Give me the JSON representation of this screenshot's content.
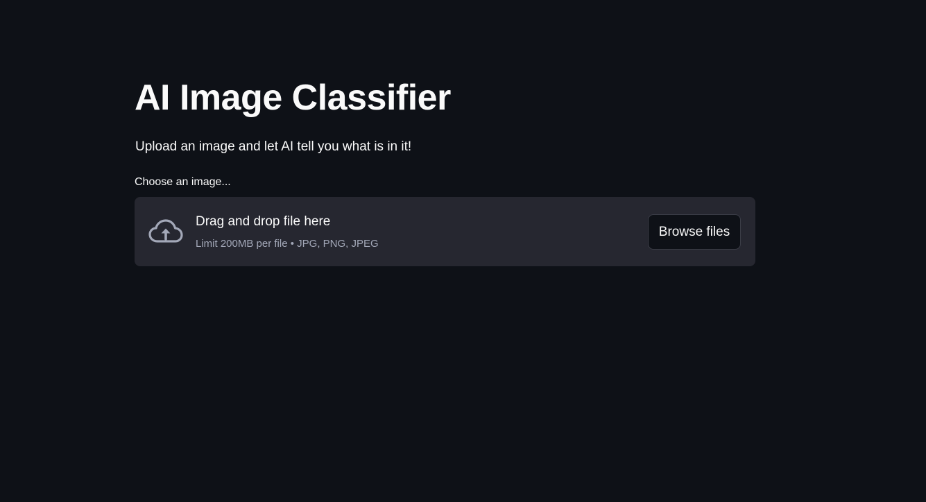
{
  "page": {
    "title": "AI Image Classifier",
    "subtitle": "Upload an image and let AI tell you what is in it!"
  },
  "uploader": {
    "label": "Choose an image...",
    "drop_title": "Drag and drop file here",
    "drop_hint": "Limit 200MB per file • JPG, PNG, JPEG",
    "browse_label": "Browse files",
    "icon": "cloud-upload-icon"
  },
  "colors": {
    "background": "#0e1117",
    "dropzone": "#262730",
    "text": "#fafafa",
    "muted_text": "#a3a8b8",
    "icon": "#a3a8b8"
  }
}
